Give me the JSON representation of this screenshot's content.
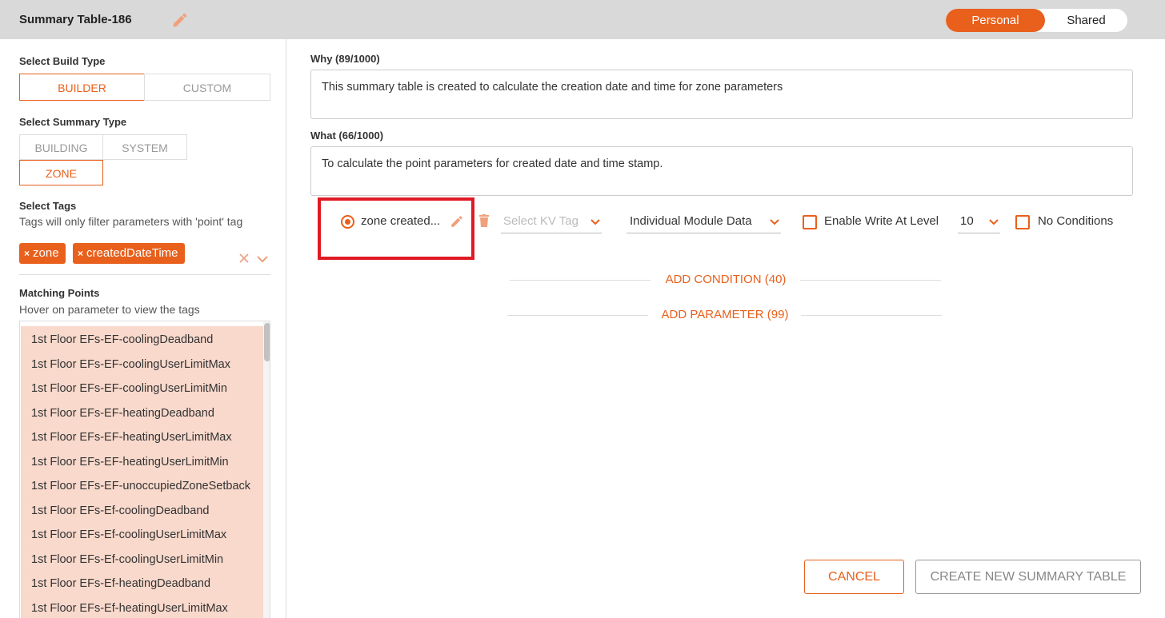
{
  "header": {
    "title": "Summary Table-186",
    "toggle": {
      "personal": "Personal",
      "shared": "Shared",
      "selected": "Personal"
    }
  },
  "left": {
    "build_type_label": "Select Build Type",
    "build_types": [
      "BUILDER",
      "CUSTOM"
    ],
    "build_type_selected": "BUILDER",
    "summary_type_label": "Select Summary Type",
    "summary_types": [
      "BUILDING",
      "SYSTEM",
      "ZONE"
    ],
    "summary_type_selected": "ZONE",
    "tags_label": "Select Tags",
    "tags_hint": "Tags will only filter parameters with 'point' tag",
    "tags": [
      "zone",
      "createdDateTime"
    ],
    "matching_label": "Matching Points",
    "matching_hint": "Hover on parameter to view the tags",
    "points": [
      "1st Floor EFs-EF-coolingDeadband",
      "1st Floor EFs-EF-coolingUserLimitMax",
      "1st Floor EFs-EF-coolingUserLimitMin",
      "1st Floor EFs-EF-heatingDeadband",
      "1st Floor EFs-EF-heatingUserLimitMax",
      "1st Floor EFs-EF-heatingUserLimitMin",
      "1st Floor EFs-EF-unoccupiedZoneSetback",
      "1st Floor EFs-Ef-coolingDeadband",
      "1st Floor EFs-Ef-coolingUserLimitMax",
      "1st Floor EFs-Ef-coolingUserLimitMin",
      "1st Floor EFs-Ef-heatingDeadband",
      "1st Floor EFs-Ef-heatingUserLimitMax"
    ]
  },
  "right": {
    "why_label": "Why (89/1000)",
    "why_text": "This summary table is created to calculate the creation date and time for zone parameters",
    "what_label": "What (66/1000)",
    "what_text": "To calculate the point parameters for created date and time stamp.",
    "param": {
      "name": "zone created...",
      "kv_tag_placeholder": "Select KV Tag",
      "data_mode": "Individual Module Data",
      "enable_write_label": "Enable Write At Level",
      "write_level": "10",
      "no_conditions_label": "No Conditions"
    },
    "add_condition": "ADD CONDITION (40)",
    "add_parameter": "ADD PARAMETER (99)",
    "cancel": "CANCEL",
    "create": "CREATE NEW SUMMARY TABLE"
  },
  "colors": {
    "accent": "#e8601c",
    "highlight": "#e01a24",
    "list_bg": "#f8d9cc",
    "header_bg": "#d9d9d9"
  },
  "icons": [
    "pencil-icon",
    "trash-icon",
    "chevron-down-icon",
    "close-icon"
  ]
}
